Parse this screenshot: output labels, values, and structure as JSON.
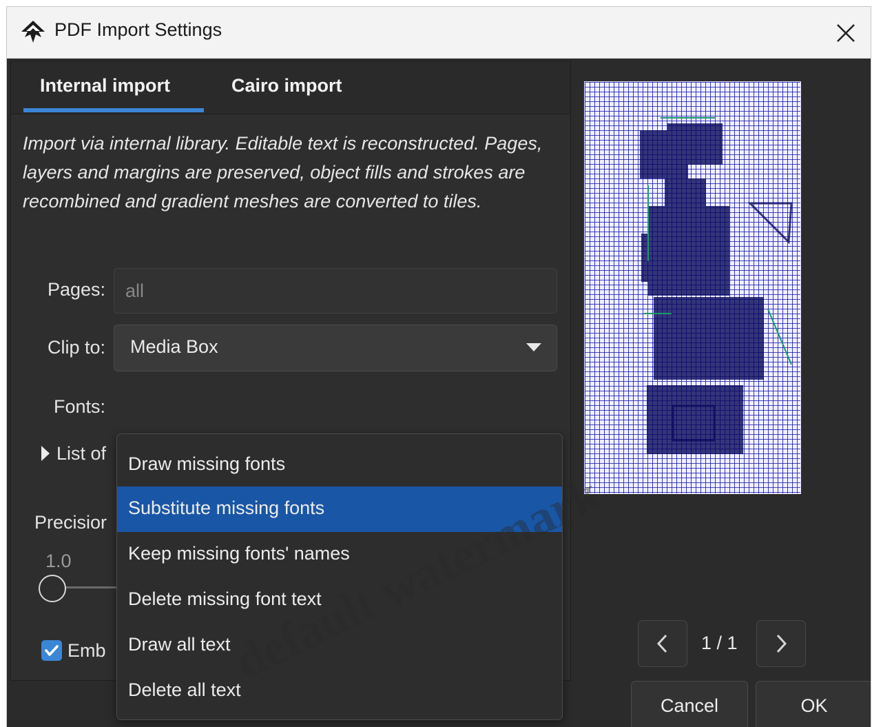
{
  "window": {
    "title": "PDF Import Settings"
  },
  "tabs": [
    {
      "label": "Internal import",
      "active": true
    },
    {
      "label": "Cairo import",
      "active": false
    }
  ],
  "description": "Import via internal library. Editable text is reconstructed. Pages, layers and margins are preserved, object fills and strokes are recombined and gradient meshes are converted to tiles.",
  "form": {
    "pages_label": "Pages:",
    "pages_value": "all",
    "clip_label": "Clip to:",
    "clip_value": "Media Box",
    "fonts_label": "Fonts:",
    "list_fonts_label": "List of",
    "precision_label": "Precisior",
    "precision_value": "1.0",
    "embed_label": "Emb",
    "embed_checked": true
  },
  "fonts_dropdown": {
    "options": [
      "Draw missing fonts",
      "Substitute missing fonts",
      "Keep missing fonts' names",
      "Delete missing font text",
      "Draw all text",
      "Delete all text"
    ],
    "selected": "Substitute missing fonts"
  },
  "pager": {
    "label": "1 / 1"
  },
  "buttons": {
    "cancel": "Cancel",
    "ok": "OK"
  },
  "watermark": "default watermark",
  "colors": {
    "accent": "#3b86d6",
    "selection": "#1a56a6",
    "preview_blue": "#0a0aa8",
    "preview_dark": "#0b0b5e"
  }
}
